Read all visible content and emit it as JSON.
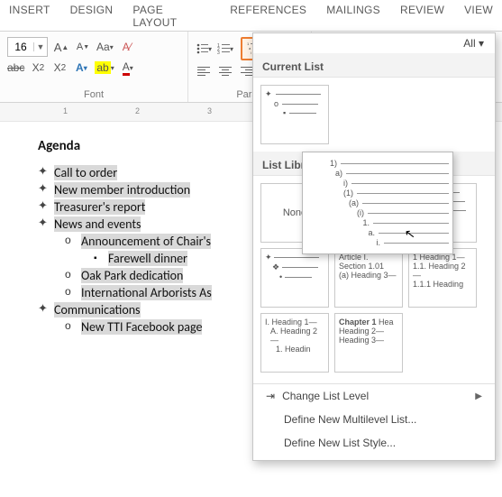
{
  "tabs": {
    "insert": "INSERT",
    "design": "DESIGN",
    "pagelayout": "PAGE LAYOUT",
    "references": "REFERENCES",
    "mailings": "MAILINGS",
    "review": "REVIEW",
    "view": "VIEW"
  },
  "ribbon": {
    "font_size": "16",
    "group_font": "Font",
    "group_para": "Parag"
  },
  "panel": {
    "all": "All ▾",
    "sec_current": "Current List",
    "sec_library": "List Libra",
    "none": "None",
    "t_article": "Article I.",
    "t_section": "Section 1.01",
    "t_a": "(a)",
    "t_h3": "Heading 3—",
    "t_111": "1.1.1",
    "t_11": "1.1.",
    "t_1": "1",
    "t_heading": "Heading",
    "t_heading1": "Heading 1—",
    "t_heading2": "Heading 2—",
    "t_rom": "I.",
    "t_A": "A.",
    "t_n1": "1.",
    "t_headin": "Headin",
    "t_chapter": "Chapter 1",
    "t_hea": "Hea",
    "menu_change": "Change List Level",
    "menu_define_ml": "Define New Multilevel List...",
    "menu_define_style": "Define New List Style..."
  },
  "tooltip": {
    "l0": "1)",
    "l1": "a)",
    "l2": "i)",
    "l3": "(1)",
    "l4": "(a)",
    "l5": "(i)",
    "l6": "1.",
    "l7": "a.",
    "l8": "i."
  },
  "doc": {
    "title": "Agenda",
    "i0": "Call to order",
    "i1": "New member introduction",
    "i2": "Treasurer's report",
    "i3": "News and events",
    "i3a": "Announcement of Chair's",
    "i3a1": "Farewell dinner",
    "i3b": "Oak Park dedication",
    "i3c": "International Arborists As",
    "i4": "Communications",
    "i4a": "New TTI Facebook page"
  },
  "ruler": {
    "m1": "1",
    "m2": "2",
    "m3": "3"
  }
}
